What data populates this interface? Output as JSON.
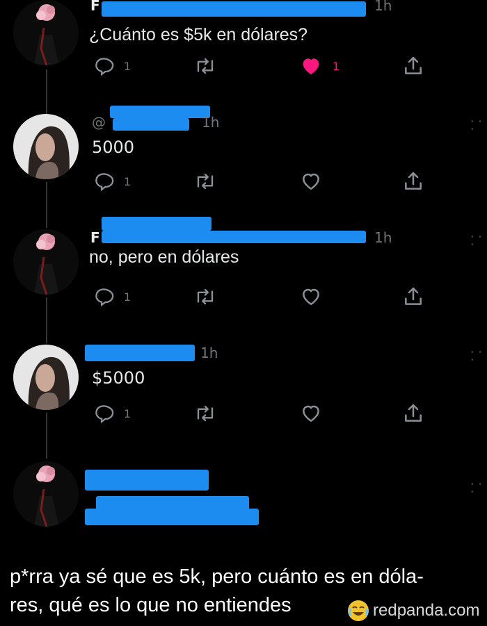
{
  "thread": [
    {
      "kind": "flower",
      "name_prefix": "F",
      "time": "1h",
      "text": "¿Cuánto es $5k en dólares?",
      "replies": "1",
      "likes": "1",
      "liked": true
    },
    {
      "kind": "girl",
      "handle_prefix": "@",
      "time": "1h",
      "text": "5000",
      "replies": "1",
      "likes": "",
      "liked": false
    },
    {
      "kind": "flower",
      "name_prefix": "F",
      "time": "1h",
      "text": "no, pero en dólares",
      "replies": "1",
      "likes": "",
      "liked": false
    },
    {
      "kind": "girl",
      "time": "1h",
      "text": "$5000",
      "replies": "1",
      "likes": "",
      "liked": false
    },
    {
      "kind": "flower",
      "text": ""
    }
  ],
  "caption": {
    "line1": "p*rra ya sé que es 5k, pero cuánto es en dóla-",
    "line2": "res, qué es lo que no entiendes"
  },
  "watermark": {
    "text": "redpanda.com"
  },
  "colors": {
    "background": "#000000",
    "text": "#e7e9ea",
    "muted": "#71767b",
    "like": "#f91880",
    "redaction": "#1d8cf0"
  },
  "icons": {
    "reply": "reply-icon",
    "retweet": "retweet-icon",
    "like": "heart-icon",
    "share": "share-icon",
    "more": "more-dots-icon",
    "emoji": "crying-laughing-emoji-icon"
  }
}
